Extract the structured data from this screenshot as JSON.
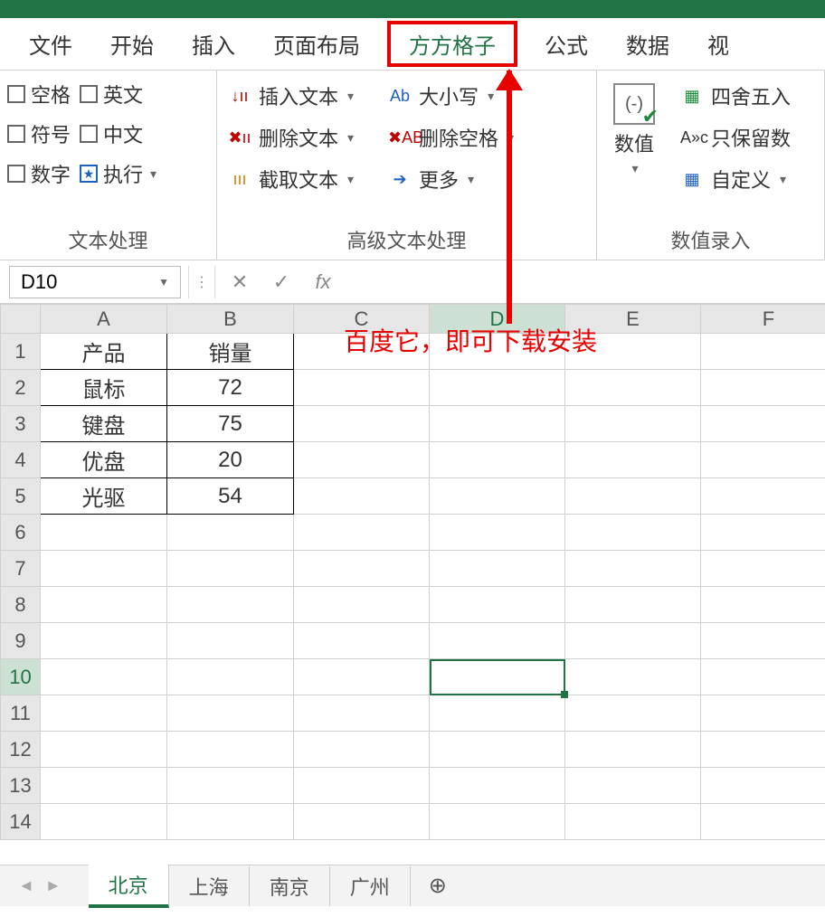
{
  "tabs": {
    "file": "文件",
    "home": "开始",
    "insert": "插入",
    "layout": "页面布局",
    "ffgz": "方方格子",
    "formula": "公式",
    "data": "数据",
    "view": "视"
  },
  "ribbon": {
    "group1": {
      "space": "空格",
      "english": "英文",
      "symbol": "符号",
      "chinese": "中文",
      "number": "数字",
      "execute": "执行",
      "label": "文本处理"
    },
    "group2": {
      "insert_text": "插入文本",
      "delete_text": "删除文本",
      "extract_text": "截取文本",
      "case": "大小写",
      "del_space": "删除空格",
      "more": "更多",
      "label": "高级文本处理"
    },
    "group3": {
      "numeric": "数值",
      "round": "四舍五入",
      "keep_num": "只保留数",
      "custom": "自定义",
      "label": "数值录入"
    }
  },
  "nameBox": "D10",
  "annotation": "百度它，即可下载安装",
  "columns": [
    "A",
    "B",
    "C",
    "D",
    "E",
    "F"
  ],
  "rows": [
    "1",
    "2",
    "3",
    "4",
    "5",
    "6",
    "7",
    "8",
    "9",
    "10",
    "11",
    "12",
    "13",
    "14"
  ],
  "table": {
    "head": [
      "产品",
      "销量"
    ],
    "rows": [
      [
        "鼠标",
        "72"
      ],
      [
        "键盘",
        "75"
      ],
      [
        "优盘",
        "20"
      ],
      [
        "光驱",
        "54"
      ]
    ]
  },
  "sheets": {
    "s1": "北京",
    "s2": "上海",
    "s3": "南京",
    "s4": "广州"
  }
}
